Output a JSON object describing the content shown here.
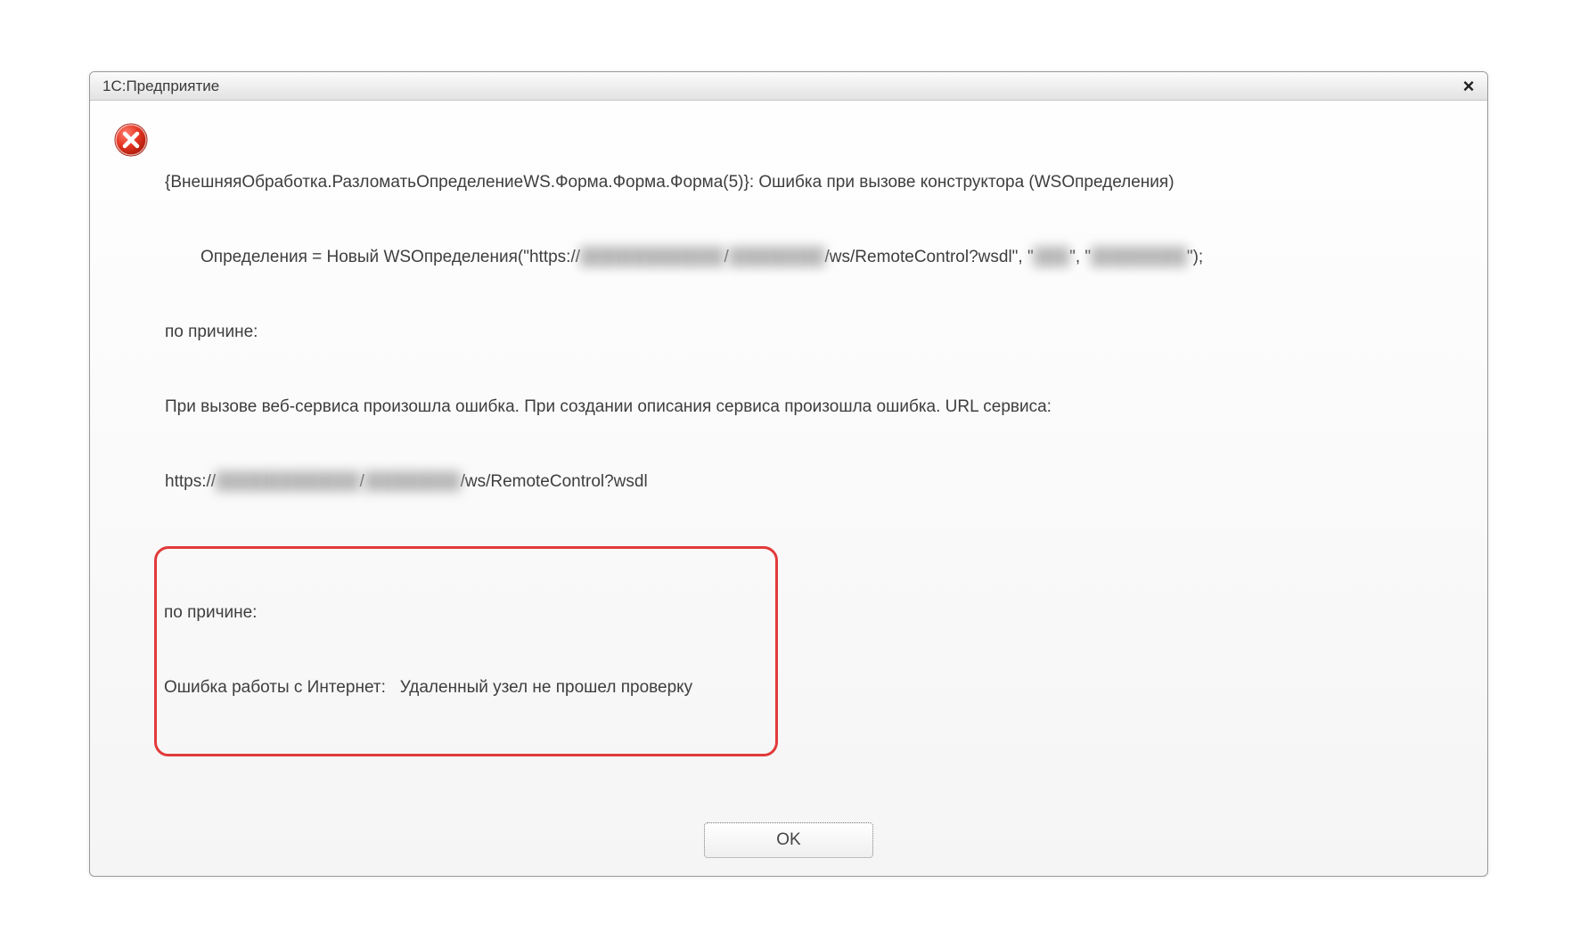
{
  "dialog": {
    "title": "1С:Предприятие",
    "close_label": "×",
    "icon": "error-icon",
    "message": {
      "line1": "{ВнешняяОбработка.РазломатьОпределениеWS.Форма.Форма.Форма(5)}: Ошибка при вызове конструктора (WSОпределения)",
      "line2_prefix": "Определения = Новый WSОпределения(\"https://",
      "line2_blur1": "████████████",
      "line2_mid1": "/",
      "line2_blur2": "████████",
      "line2_mid2": "/ws/RemoteControl?wsdl\", \"",
      "line2_blur3": "███",
      "line2_mid3": "\", \"",
      "line2_blur4": "████████",
      "line2_suffix": "\");",
      "line3": "по причине:",
      "line4_prefix": "При вызове веб-сервиса произошла ошибка. При создании описания сервиса произошла ошибка. URL сервиса:",
      "line5_prefix": "https://",
      "line5_blur1": "████████████",
      "line5_mid": "/",
      "line5_blur2": "████████",
      "line5_suffix": "/ws/RemoteControl?wsdl",
      "highlighted": {
        "h1": "по причине:",
        "h2": "Ошибка работы с Интернет:   Удаленный узел не прошел проверку"
      }
    },
    "ok_label": "OK"
  }
}
